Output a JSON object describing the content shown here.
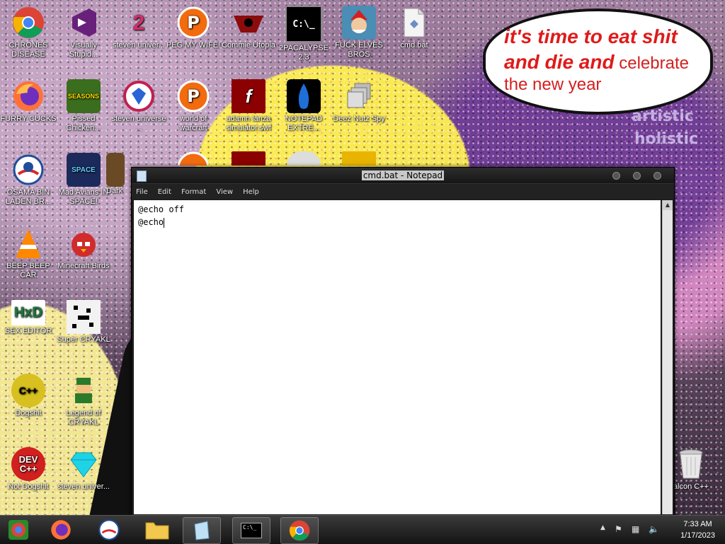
{
  "speech_bubble": {
    "line1": "it's time to eat shit",
    "line2_bold": "and die and",
    "line2_thin": " celebrate",
    "line3": "the new year"
  },
  "wallpaper_text": {
    "a": "artistic",
    "b": "holistic"
  },
  "desktop_icons": [
    {
      "label": "CHRONES DISEASE",
      "icon": "chrome-icon"
    },
    {
      "label": "Visually Stupid...",
      "icon": "visual-studio-icon"
    },
    {
      "label": "steven univer...",
      "icon": "steven-universe-icon"
    },
    {
      "label": "PEG MY WIFE!",
      "icon": "peggle-icon"
    },
    {
      "label": "Commie Utopia",
      "icon": "commie-icon"
    },
    {
      "label": "2PACALYPSE 2.3",
      "icon": "cmd-icon"
    },
    {
      "label": "FUCK ELVES BROS",
      "icon": "elf-icon"
    },
    {
      "label": "cmd.bat",
      "icon": "bat-file-icon"
    },
    {
      "label": "FURRY CUCKS",
      "icon": "firefox-icon"
    },
    {
      "label": "Pissed Chicken...",
      "icon": "angry-birds-icon"
    },
    {
      "label": "steven universe ...",
      "icon": "gem-icon"
    },
    {
      "label": "world of warcraft",
      "icon": "peggle-icon"
    },
    {
      "label": "adamn lanza simulator.swf",
      "icon": "flash-icon"
    },
    {
      "label": "NOTEPAD EXTRE...",
      "icon": "notepad-plus-icon"
    },
    {
      "label": "Deez Nutz Spy",
      "icon": "windows-icon"
    },
    {
      "label": "OSAMA BIN LADEN BR...",
      "icon": "obama-icon"
    },
    {
      "label": "Mad Avians IN SPACE!",
      "icon": "angry-birds-space-icon"
    },
    {
      "label": "Dark",
      "icon": "dark-icon"
    },
    {
      "label": "BEEP BEEP CAR",
      "icon": "vlc-icon"
    },
    {
      "label": "Minecraft Birds",
      "icon": "minecraft-birds-icon"
    },
    {
      "label": "SEX EDITOR",
      "icon": "hxd-icon"
    },
    {
      "label": "Super CRYAKL",
      "icon": "cryakl-icon"
    },
    {
      "label": "Dogshit",
      "icon": "dogshit-icon"
    },
    {
      "label": "Legend of CRYAKL",
      "icon": "legend-icon"
    },
    {
      "label": "Not Dogshit",
      "icon": "devcpp-icon"
    },
    {
      "label": "steven univer...",
      "icon": "diamond-icon"
    },
    {
      "label": "alcon C++",
      "icon": "recycle-bin-icon"
    }
  ],
  "notepad": {
    "title": "cmd.bat - Notepad",
    "menu": [
      "File",
      "Edit",
      "Format",
      "View",
      "Help"
    ],
    "lines": [
      "@echo off",
      "@echo"
    ]
  },
  "taskbar": {
    "time": "7:33 AM",
    "date": "1/17/2023"
  }
}
